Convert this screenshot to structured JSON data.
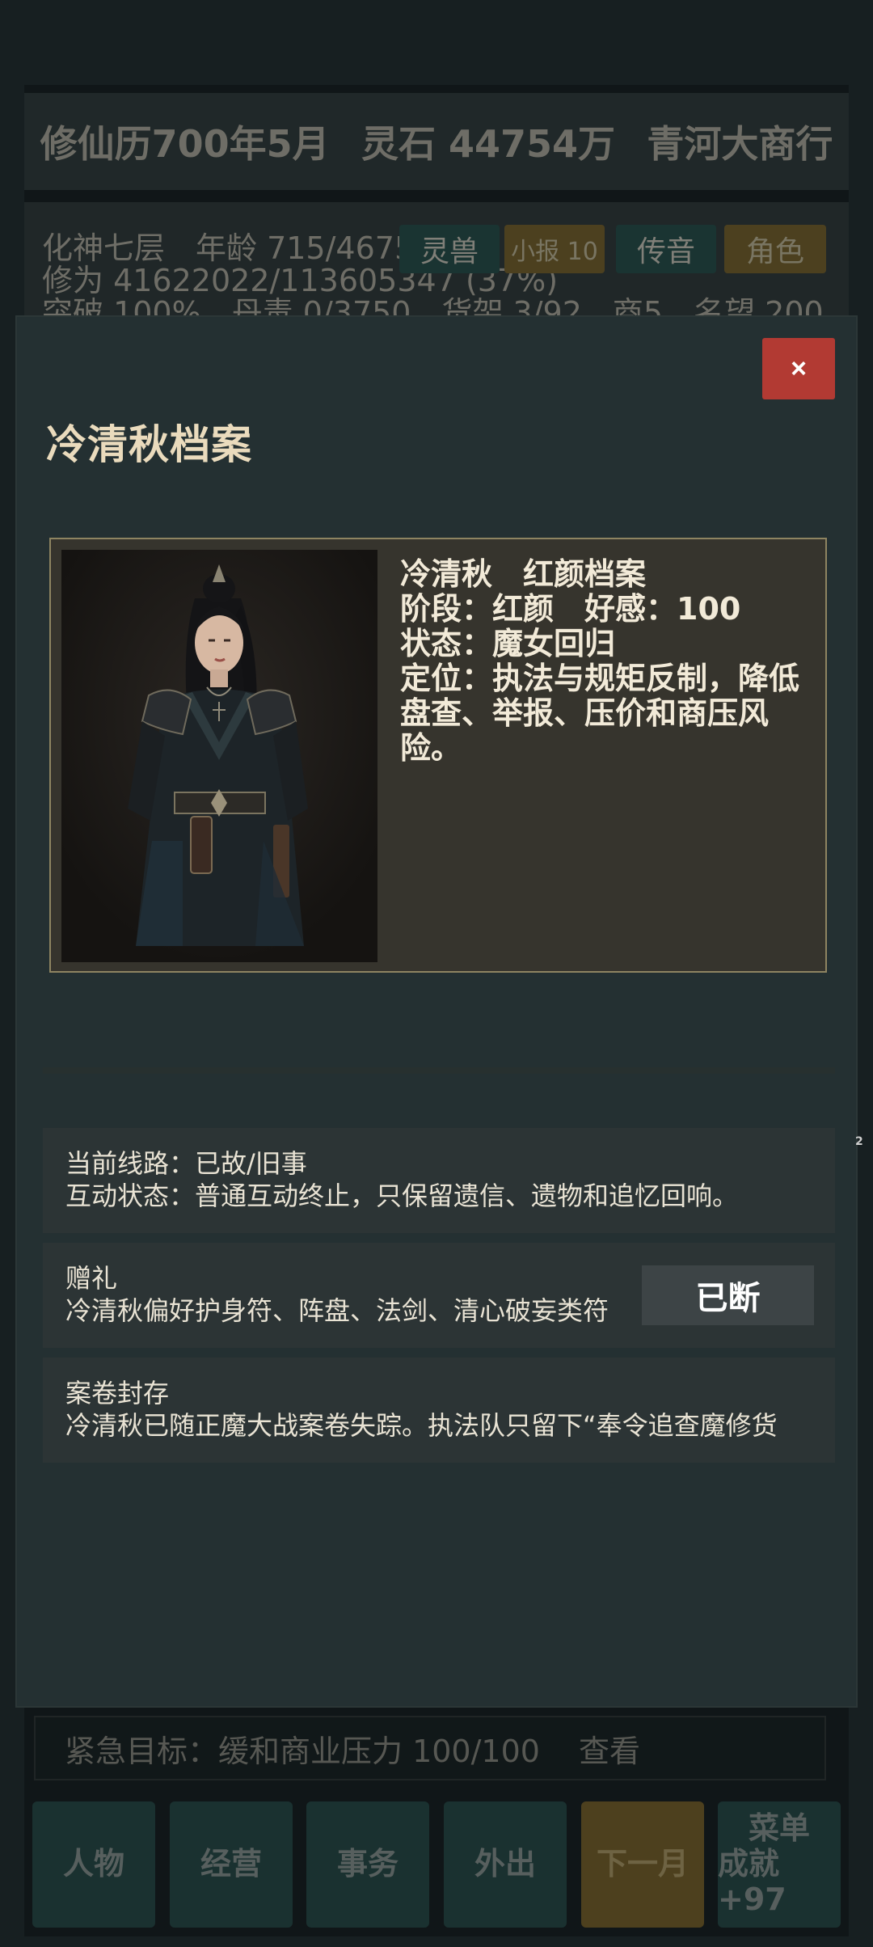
{
  "hud": {
    "date": "修仙历700年5月",
    "spirit_stones": "灵石 44754万",
    "shop_name": "青河大商行"
  },
  "stats": {
    "line1": "化神七层　年龄 715/4675",
    "line2": "修为 41622022/113605347 (37%)",
    "line3": "突破 100%　丹毒 0/3750　货架 3/92　商5　名望 200"
  },
  "quick_buttons": {
    "beast": "灵兽",
    "news": "小报 10",
    "message": "传音",
    "role": "角色"
  },
  "goal": {
    "text": "紧急目标：缓和商业压力 100/100",
    "view": "查看"
  },
  "nav": {
    "character": "人物",
    "business": "经营",
    "affairs": "事务",
    "outing": "外出",
    "next_month": "下一月",
    "menu": "菜单",
    "achievements": "成就+97"
  },
  "modal": {
    "title": "冷清秋档案",
    "close_label": "×",
    "profile": {
      "line1": "冷清秋　红颜档案",
      "line2": "阶段：红颜　好感：100",
      "line3": "状态：魔女回归",
      "line4": "定位：执法与规矩反制，降低盘查、举报、压价和商压风险。"
    },
    "route": {
      "line1": "当前线路：已故/旧事",
      "line2": "互动状态：普通互动终止，只保留遗信、遗物和追忆回响。"
    },
    "gift": {
      "title": "赠礼",
      "desc": "冷清秋偏好护身符、阵盘、法剑、清心破妄类符",
      "button": "已断"
    },
    "archive": {
      "title": "案卷封存",
      "desc": "冷清秋已随正魔大战案卷失踪。执法队只留下“奉令追查魔修货"
    }
  },
  "edge_mark": "2",
  "colors": {
    "close_button": "#b23a33",
    "title_gold": "#eadbbd",
    "card_border": "#8e8461",
    "teal_button": "#1f4944",
    "gold_button": "#7a6022"
  }
}
